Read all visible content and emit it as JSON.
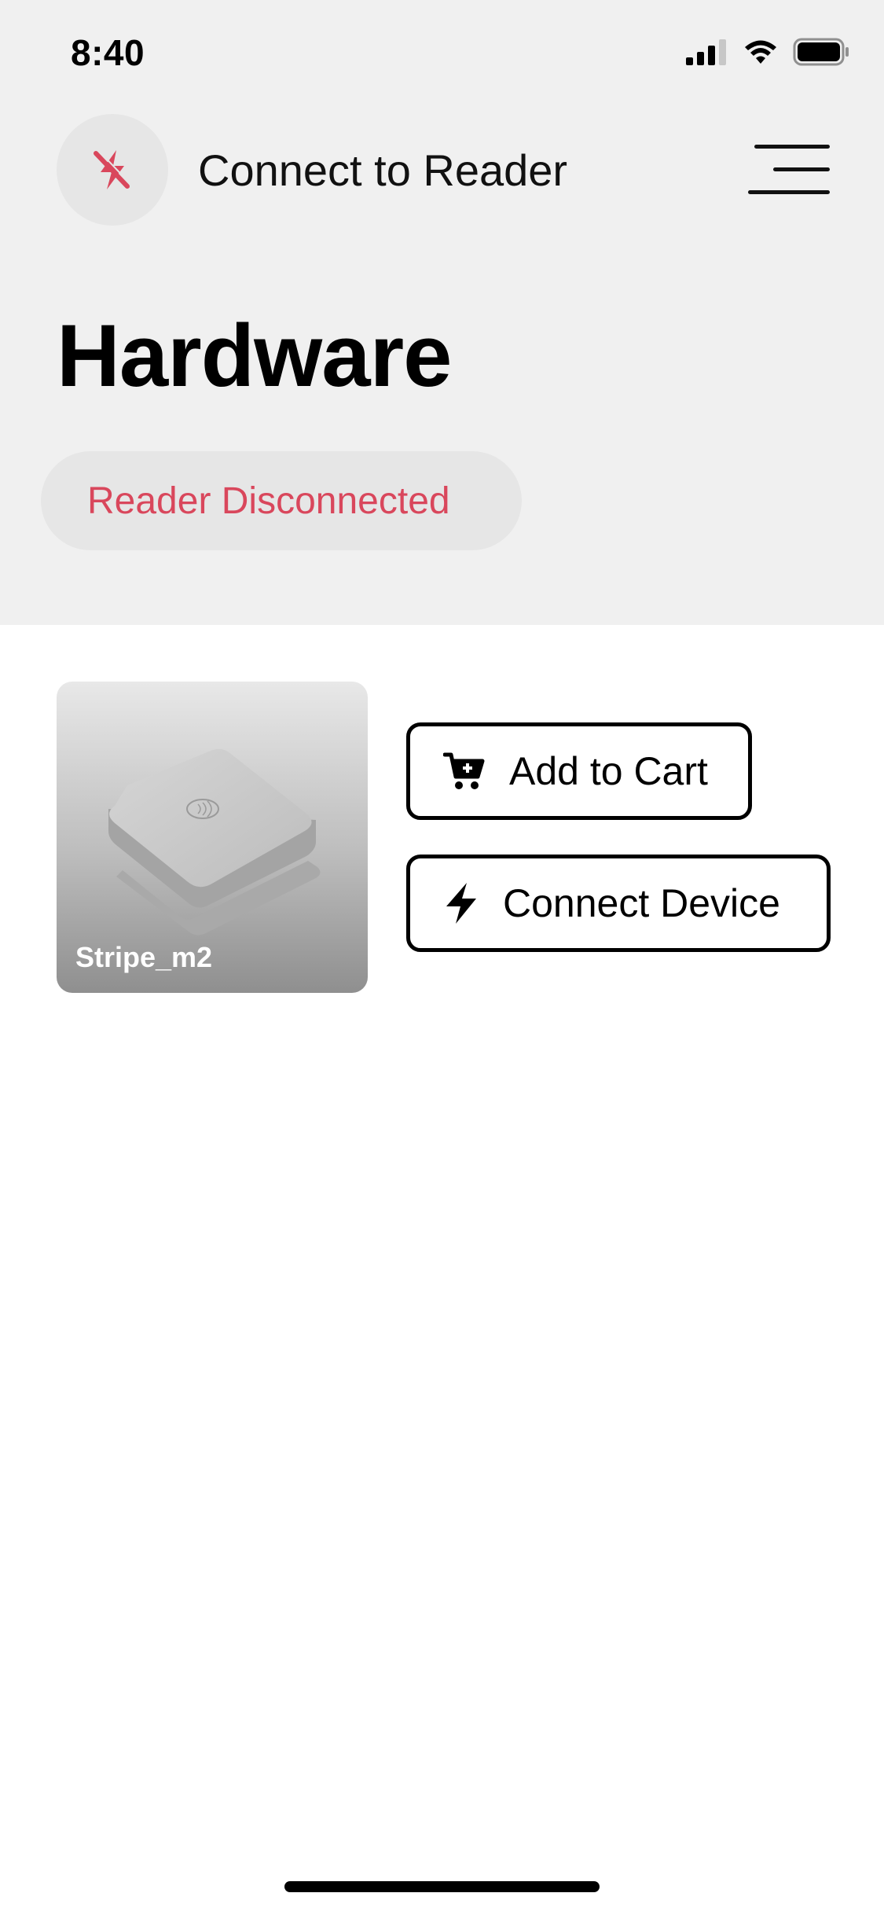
{
  "status_bar": {
    "time": "8:40",
    "icons": [
      "signal-icon",
      "wifi-icon",
      "battery-icon"
    ]
  },
  "header": {
    "title": "Connect to Reader",
    "reader_icon": "lightning-off-icon",
    "menu_icon": "hamburger-menu-icon"
  },
  "page": {
    "title": "Hardware"
  },
  "reader_status": {
    "text": "Reader Disconnected",
    "color": "#d9475c"
  },
  "device": {
    "name": "Stripe_m2",
    "actions": {
      "add_to_cart": {
        "label": "Add to Cart",
        "icon": "cart-plus-icon"
      },
      "connect": {
        "label": "Connect Device",
        "icon": "lightning-icon"
      }
    }
  },
  "colors": {
    "accent": "#d9475c",
    "header_bg": "#f0f0f0",
    "pill_bg": "#e6e6e6"
  }
}
